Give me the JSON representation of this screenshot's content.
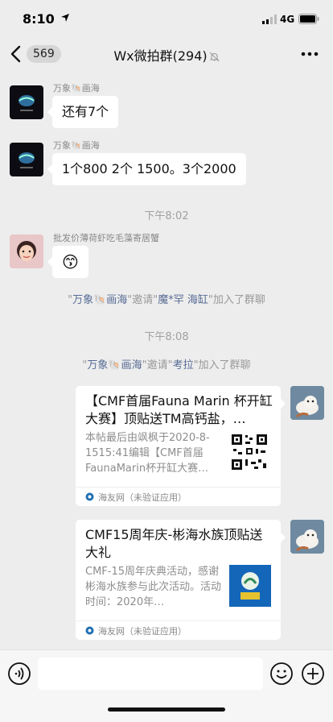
{
  "status_bar": {
    "time": "8:10",
    "network": "4G"
  },
  "nav": {
    "badge": "569",
    "title": "Wx微拍群(294)"
  },
  "messages": [
    {
      "sender": "万象🐚画海",
      "text": "还有7个"
    },
    {
      "sender": "万象🐚画海",
      "text": "1个800 2个 1500。3个2000"
    }
  ],
  "timestamp1": "下午8:02",
  "message3": {
    "sender": "批发价薄荷虾吃毛藻寄居蟹",
    "emoji": "😙"
  },
  "system1": {
    "q1": "\"",
    "inviter": "万象🐚画海",
    "mid": "\"邀请\"",
    "invitee": "魔*罕 海缸",
    "end": "\"加入了群聊"
  },
  "timestamp2": "下午8:08",
  "system2": {
    "q1": "\"",
    "inviter": "万象🐚画海",
    "mid": "\"邀请\"",
    "invitee": "考拉",
    "end": "\"加入了群聊"
  },
  "card1": {
    "title": "【CMF首届Fauna Marin 杯开缸大赛】顶贴送TM高钙盐，…",
    "desc": "本帖最后由飒枫于2020-8-1515:41编辑【CMF首届FaunaMarin杯开缸大赛…",
    "source": "海友网（未验证应用）"
  },
  "card2": {
    "title": "CMF15周年庆-彬海水族顶贴送大礼",
    "desc": "CMF-15周年庆典活动，感谢彬海水族参与此次活动。活动时间：2020年…",
    "source": "海友网（未验证应用）"
  },
  "icons": {
    "back": "chevron-left-icon",
    "mute": "bell-off-icon",
    "more": "more-dots-icon",
    "voice": "voice-icon",
    "emoji": "smiley-icon",
    "plus": "plus-circle-icon"
  },
  "colors": {
    "link": "#576b95",
    "background": "#ededed"
  }
}
